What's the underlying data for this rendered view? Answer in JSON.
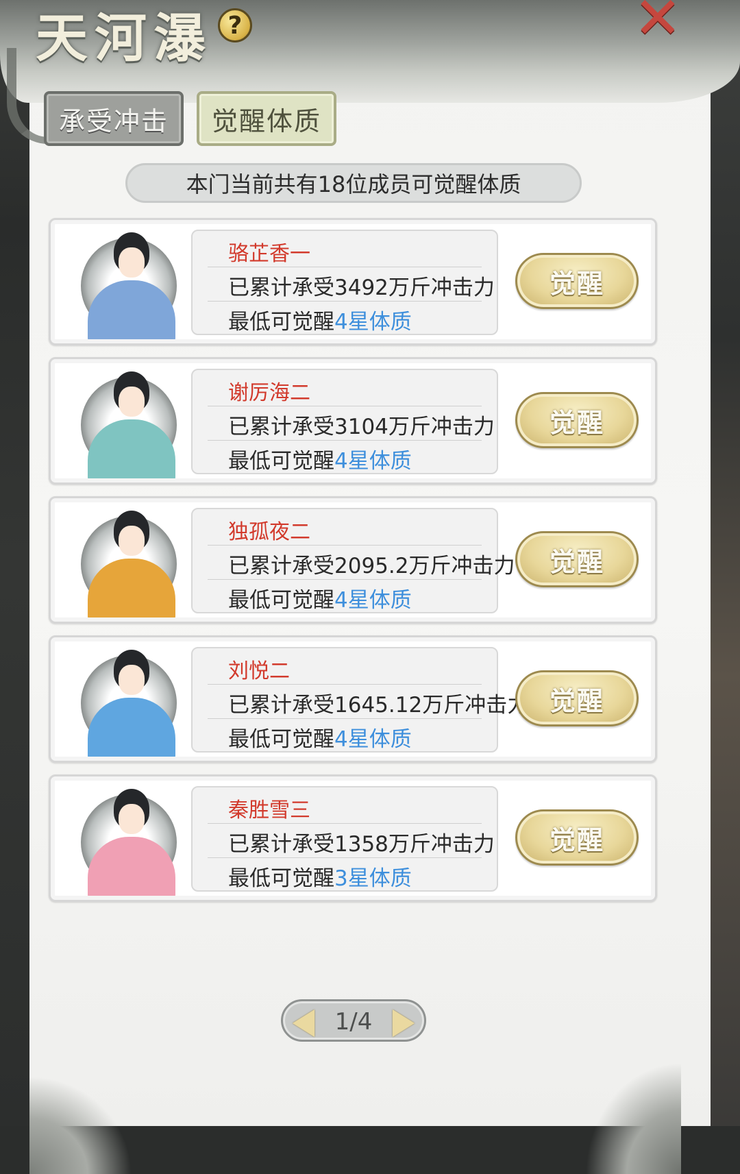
{
  "header": {
    "title": "天河瀑",
    "help_glyph": "?",
    "close_glyph": "✕"
  },
  "tabs": [
    {
      "label": "承受冲击",
      "active": false
    },
    {
      "label": "觉醒体质",
      "active": true
    }
  ],
  "summary": "本门当前共有18位成员可觉醒体质",
  "members": [
    {
      "name": "骆芷香一",
      "impact": "已累计承受3492万斤冲击力",
      "min_prefix": "最低可觉醒",
      "star": "4星体质",
      "button": "觉醒",
      "robe_color": "#7fa6d9"
    },
    {
      "name": "谢厉海二",
      "impact": "已累计承受3104万斤冲击力",
      "min_prefix": "最低可觉醒",
      "star": "4星体质",
      "button": "觉醒",
      "robe_color": "#7fc4c1"
    },
    {
      "name": "独孤夜二",
      "impact": "已累计承受2095.2万斤冲击力",
      "min_prefix": "最低可觉醒",
      "star": "4星体质",
      "button": "觉醒",
      "robe_color": "#e6a53a"
    },
    {
      "name": "刘悦二",
      "impact": "已累计承受1645.12万斤冲击力",
      "min_prefix": "最低可觉醒",
      "star": "4星体质",
      "button": "觉醒",
      "robe_color": "#5fa6e0"
    },
    {
      "name": "秦胜雪三",
      "impact": "已累计承受1358万斤冲击力",
      "min_prefix": "最低可觉醒",
      "star": "3星体质",
      "button": "觉醒",
      "robe_color": "#f0a0b4"
    }
  ],
  "pager": {
    "text": "1/4"
  }
}
